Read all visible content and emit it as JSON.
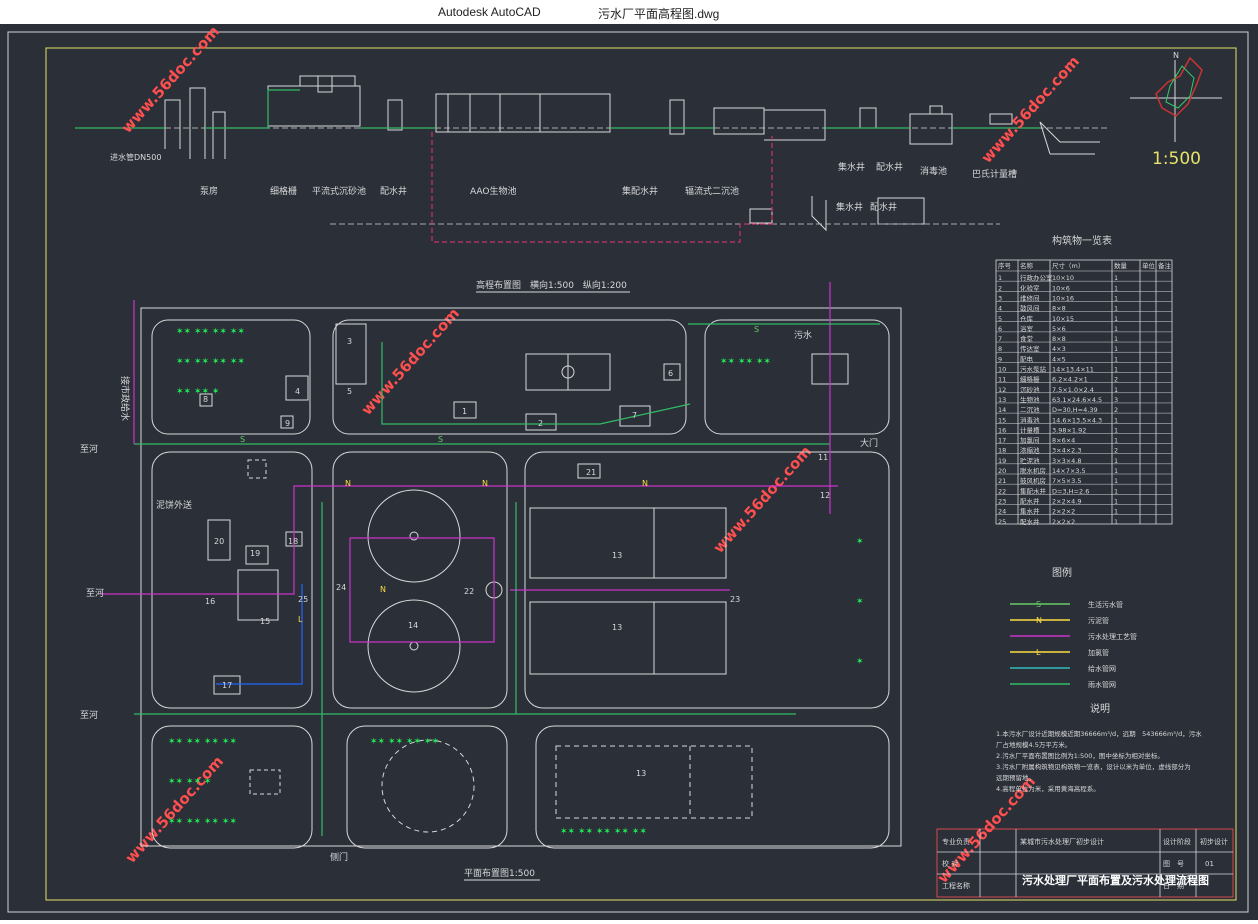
{
  "window": {
    "app_title": "Autodesk AutoCAD",
    "document_title": "污水厂平面高程图.dwg"
  },
  "watermark": "www.56doc.com",
  "scale": "1:500",
  "north": "N",
  "profile": {
    "inlet_label": "进水管DN500",
    "structures": [
      "泵房",
      "细格栅",
      "平流式沉砂池",
      "配水井",
      "AAO生物池",
      "集配水井",
      "辐流式二沉池",
      "集水井",
      "配水井",
      "消毒池",
      "巴氏计量槽"
    ],
    "lower": [
      "集水井",
      "配水井"
    ]
  },
  "elevation_title": "高程布置图　横向1:500　纵向1:200",
  "plan_title": "平面布置图1:500",
  "plan_labels": {
    "to_river": "至河",
    "to_river2": "至河",
    "to_river3": "至河",
    "water_supply": "接市政给水",
    "sewage": "污水",
    "main_gate": "大门",
    "side_gate": "侧门",
    "sludge_out": "泥饼外送"
  },
  "table": {
    "title": "构筑物一览表",
    "headers": [
      "序号",
      "名称",
      "尺寸（m）",
      "数量",
      "单位",
      "备注"
    ],
    "rows": [
      [
        "1",
        "行政办公室",
        "10×10",
        "1",
        "",
        ""
      ],
      [
        "2",
        "化验室",
        "10×6",
        "1",
        "",
        ""
      ],
      [
        "3",
        "维修间",
        "10×16",
        "1",
        "",
        ""
      ],
      [
        "4",
        "鼓风间",
        "8×8",
        "1",
        "",
        ""
      ],
      [
        "5",
        "仓库",
        "10×15",
        "1",
        "",
        ""
      ],
      [
        "6",
        "浴室",
        "5×6",
        "1",
        "",
        ""
      ],
      [
        "7",
        "食堂",
        "8×8",
        "1",
        "",
        ""
      ],
      [
        "8",
        "传达室",
        "4×3",
        "1",
        "",
        ""
      ],
      [
        "9",
        "配电",
        "4×5",
        "1",
        "",
        ""
      ],
      [
        "10",
        "污水泵站",
        "14×13.4×11",
        "1",
        "",
        ""
      ],
      [
        "11",
        "细格栅",
        "6.2×4.2×1",
        "2",
        "",
        ""
      ],
      [
        "12",
        "沉砂池",
        "7.5×1.0×2.4",
        "1",
        "",
        ""
      ],
      [
        "13",
        "生物池",
        "63.1×24.6×4.5",
        "3",
        "",
        ""
      ],
      [
        "14",
        "二沉池",
        "D=30,H=4.39",
        "2",
        "",
        ""
      ],
      [
        "15",
        "消毒池",
        "14.6×13.5×4.3",
        "1",
        "",
        ""
      ],
      [
        "16",
        "计量槽",
        "3.98×1.92",
        "1",
        "",
        ""
      ],
      [
        "17",
        "加氯间",
        "8×6×4",
        "1",
        "",
        ""
      ],
      [
        "18",
        "浓缩池",
        "3×4×2.3",
        "2",
        "",
        ""
      ],
      [
        "19",
        "贮泥池",
        "3×3×4.8",
        "1",
        "",
        ""
      ],
      [
        "20",
        "脱水机房",
        "14×7×3.5",
        "1",
        "",
        ""
      ],
      [
        "21",
        "鼓风机房",
        "7×5×3.5",
        "1",
        "",
        ""
      ],
      [
        "22",
        "集配水井",
        "D=3,H=2.6",
        "1",
        "",
        ""
      ],
      [
        "23",
        "配水井",
        "2×2×4.9",
        "1",
        "",
        ""
      ],
      [
        "24",
        "集水井",
        "2×2×2",
        "1",
        "",
        ""
      ],
      [
        "25",
        "配水井",
        "2×2×2",
        "1",
        "",
        ""
      ]
    ]
  },
  "legend": {
    "title": "图例",
    "items": [
      {
        "symbol": "S",
        "label": "生活污水管",
        "color": "#66cc66"
      },
      {
        "symbol": "N",
        "label": "污泥管",
        "color": "#ffdd44"
      },
      {
        "symbol": "",
        "label": "污水处理工艺管",
        "color": "#cc33cc"
      },
      {
        "symbol": "L",
        "label": "加氯管",
        "color": "#ffdd44"
      },
      {
        "symbol": "",
        "label": "给水管网",
        "color": "#33bbbb"
      },
      {
        "symbol": "",
        "label": "雨水管网",
        "color": "#33bb66"
      }
    ]
  },
  "notes": {
    "title": "说明",
    "lines": [
      "1.本污水厂设计近期规模近期36666m³/d，远期　543666m³/d，污水",
      "厂占地规模4.5万平方米。",
      "2.污水厂平面布置图比例为1:500，图中坐标为相对坐标。",
      "3.污水厂附属构筑物见构筑物一览表，设计以米为单位，虚线部分为",
      "远期预留地。",
      "4.高程单位为米，采用黄海高程系。"
    ]
  },
  "title_block": {
    "c1": [
      "专业负责",
      "校  对",
      "工程名称"
    ],
    "c2": "设计阶段",
    "c3": "初步设计",
    "drawing_title": "污水处理厂平面布置及污水处理流程图",
    "drawing_no_label": "图　号",
    "drawing_no": "01",
    "date_label": "日　期",
    "project": "某城市污水处理厂初步设计"
  }
}
